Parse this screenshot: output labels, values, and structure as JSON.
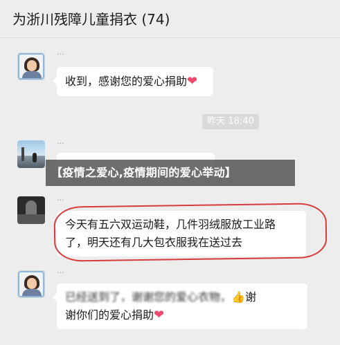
{
  "header": {
    "title": "为浙川残障儿童捐衣 (74)"
  },
  "messages": [
    {
      "sender": "…",
      "text": "收到，感谢您的爱心捐助",
      "emoji": "❤"
    },
    {
      "timestamp": "昨天 18:40"
    },
    {
      "sender": "…",
      "text": ""
    },
    {
      "sender": "…",
      "line1": "今天有五六双运动鞋，几件羽绒服放工业路",
      "line2": "了，明天还有几大包衣服我在送过去"
    },
    {
      "sender": "…",
      "line1_blurred": "已经送到了，谢谢您的爱心衣物，",
      "thumb": "👍",
      "line1_tail": "谢",
      "line2": "谢你们的爱心捐助",
      "emoji": "❤"
    }
  ],
  "banner": {
    "text": "【疫情之爱心,疫情期间的爱心举动】"
  },
  "colors": {
    "background": "#ededed",
    "bubble": "#ffffff",
    "heart": "#ef4a6e",
    "annotation": "#d83a3a"
  }
}
